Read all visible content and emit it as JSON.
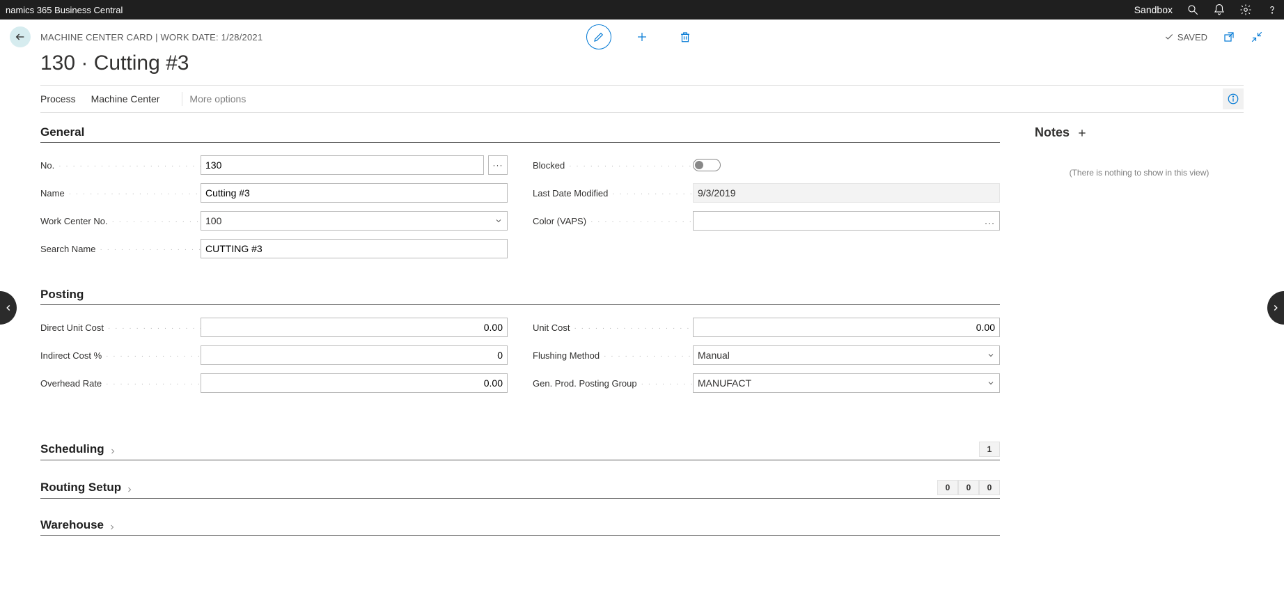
{
  "topbar": {
    "title": "namics 365 Business Central",
    "environment": "Sandbox"
  },
  "header": {
    "breadcrumb": "MACHINE CENTER CARD | WORK DATE: 1/28/2021",
    "saved": "SAVED"
  },
  "title": "130 · Cutting #3",
  "actions": {
    "process": "Process",
    "machine_center": "Machine Center",
    "more": "More options"
  },
  "general": {
    "heading": "General",
    "no_label": "No.",
    "no_value": "130",
    "name_label": "Name",
    "name_value": "Cutting #3",
    "work_center_no_label": "Work Center No.",
    "work_center_no_value": "100",
    "search_name_label": "Search Name",
    "search_name_value": "CUTTING #3",
    "blocked_label": "Blocked",
    "last_modified_label": "Last Date Modified",
    "last_modified_value": "9/3/2019",
    "color_label": "Color (VAPS)",
    "color_value": ""
  },
  "posting": {
    "heading": "Posting",
    "direct_unit_cost_label": "Direct Unit Cost",
    "direct_unit_cost_value": "0.00",
    "indirect_cost_label": "Indirect Cost %",
    "indirect_cost_value": "0",
    "overhead_rate_label": "Overhead Rate",
    "overhead_rate_value": "0.00",
    "unit_cost_label": "Unit Cost",
    "unit_cost_value": "0.00",
    "flushing_method_label": "Flushing Method",
    "flushing_method_value": "Manual",
    "gen_prod_posting_label": "Gen. Prod. Posting Group",
    "gen_prod_posting_value": "MANUFACT"
  },
  "scheduling": {
    "heading": "Scheduling",
    "badges": [
      "1"
    ]
  },
  "routing": {
    "heading": "Routing Setup",
    "badges": [
      "0",
      "0",
      "0"
    ]
  },
  "warehouse": {
    "heading": "Warehouse"
  },
  "notes": {
    "heading": "Notes",
    "empty": "(There is nothing to show in this view)"
  }
}
